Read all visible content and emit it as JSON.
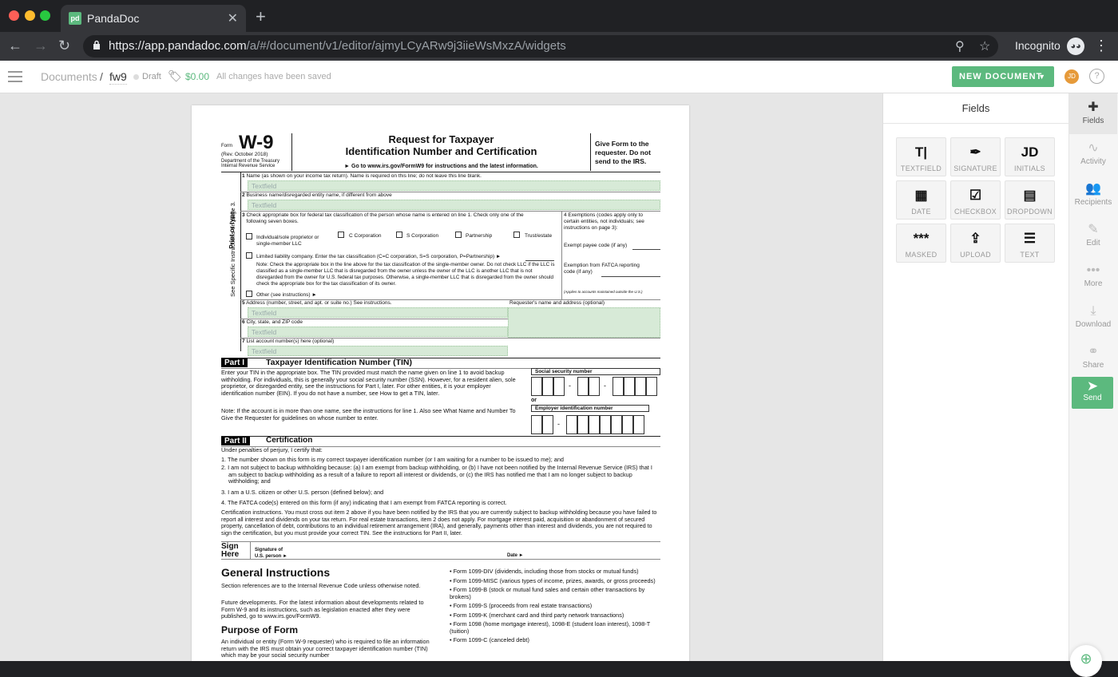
{
  "browser": {
    "tab_title": "PandaDoc",
    "favicon_text": "pd",
    "url_host": "https://app.pandadoc.com",
    "url_path": "/a/#/document/v1/editor/ajmyLCyARw9j3iieWsMxzA/widgets",
    "profile_label": "Incognito",
    "traffic_lights": {
      "close": "#ff5f57",
      "minimize": "#febc2e",
      "maximize": "#28c840"
    }
  },
  "header": {
    "breadcrumb_root": "Documents",
    "separator": "/",
    "doc_name": "fw9",
    "status": "Draft",
    "price": "$0.00",
    "save_status": "All changes have been saved",
    "new_document_label": "NEW DOCUMENT",
    "avatar_initials": "JD",
    "help_label": "?",
    "accent": "#5cb97e"
  },
  "fields_panel": {
    "title": "Fields",
    "tiles": [
      {
        "label": "TEXTFIELD",
        "icon": "textfield-icon",
        "glyph": "T|"
      },
      {
        "label": "SIGNATURE",
        "icon": "pen-nib-icon",
        "glyph": "✒"
      },
      {
        "label": "INITIALS",
        "icon": "initials-icon",
        "glyph": "JD"
      },
      {
        "label": "DATE",
        "icon": "calendar-icon",
        "glyph": "▦"
      },
      {
        "label": "CHECKBOX",
        "icon": "checkbox-icon",
        "glyph": "☑"
      },
      {
        "label": "DROPDOWN",
        "icon": "dropdown-icon",
        "glyph": "▤"
      },
      {
        "label": "MASKED",
        "icon": "masked-icon",
        "glyph": "***"
      },
      {
        "label": "UPLOAD",
        "icon": "upload-icon",
        "glyph": "⇪"
      },
      {
        "label": "TEXT",
        "icon": "text-lines-icon",
        "glyph": "☰"
      }
    ]
  },
  "rail": {
    "items": [
      {
        "label": "Fields",
        "icon": "puzzle-icon",
        "glyph": "✚",
        "active": true
      },
      {
        "label": "Activity",
        "icon": "pulse-icon",
        "glyph": "∿"
      },
      {
        "label": "Recipients",
        "icon": "people-icon",
        "glyph": "👥"
      },
      {
        "label": "Edit",
        "icon": "edit-icon",
        "glyph": "✎"
      },
      {
        "label": "More",
        "icon": "more-icon",
        "glyph": "•••"
      },
      {
        "label": "Download",
        "icon": "download-icon",
        "glyph": "⤓"
      },
      {
        "label": "Share",
        "icon": "link-icon",
        "glyph": "⚭"
      }
    ],
    "send_label": "Send"
  },
  "form": {
    "form_word": "Form",
    "form_number": "W-9",
    "rev": "(Rev. October 2018)",
    "dept1": "Department of the Treasury",
    "dept2": "Internal Revenue Service",
    "title1": "Request for Taxpayer",
    "title2": "Identification Number and Certification",
    "goto": "► Go to www.irs.gov/FormW9 for instructions and the latest information.",
    "give1": "Give Form to the",
    "give2": "requester. Do not",
    "give3": "send to the IRS.",
    "side1": "Print or type.",
    "side2": "See Specific Instructions on page 3.",
    "placeholder": "Textfield",
    "line1": "Name (as shown on your income tax return). Name is required on this line; do not leave this line blank.",
    "line2": "Business name/disregarded entity name, if different from above",
    "line3a": "Check appropriate box for federal tax classification of the person whose name is entered on line 1. Check only one of the",
    "line3b": "following seven boxes.",
    "opt_individual1": "Individual/sole proprietor or",
    "opt_individual2": "single-member LLC",
    "opt_c": "C Corporation",
    "opt_s": "S Corporation",
    "opt_p": "Partnership",
    "opt_t": "Trust/estate",
    "opt_llc": "Limited liability company. Enter the tax classification (C=C corporation, S=S corporation, P=Partnership) ►",
    "note_llc": "Note: Check the appropriate box in the line above for the tax classification of the single-member owner.  Do not check LLC if the LLC is classified as a single-member LLC that is disregarded from the owner unless the owner of the LLC is another LLC that is not disregarded from the owner for U.S. federal tax purposes. Otherwise, a single-member LLC that is disregarded from the owner should check the appropriate box for the tax classification of its owner.",
    "opt_other": "Other (see instructions) ►",
    "ex_title": "4  Exemptions (codes apply only to certain entities, not individuals; see instructions on page 3):",
    "ex_payee": "Exempt payee code (if any)",
    "ex_fatca": "Exemption from FATCA reporting code (if any)",
    "ex_applies": "(Applies to accounts maintained outside the U.S.)",
    "line5": "Address (number, street, and apt. or suite no.) See instructions.",
    "requester": "Requester's name and address (optional)",
    "line6": "City, state, and ZIP code",
    "line7": "List account number(s) here (optional)",
    "part1_tag": "Part I",
    "part1_title": "Taxpayer Identification Number (TIN)",
    "part1_text": "Enter your TIN in the appropriate box. The TIN provided must match the name given on line 1 to avoid backup withholding. For individuals, this is generally your social security number (SSN). However, for a resident alien, sole proprietor, or disregarded entity, see the instructions for Part I, later. For other entities, it is your employer identification number (EIN). If you do not have a number, see How to get a TIN, later.",
    "part1_note": "Note: If the account is in more than one name, see the instructions for line 1. Also see What Name and Number To Give the Requester for guidelines on whose number to enter.",
    "ssn_label": "Social security number",
    "or_label": "or",
    "ein_label": "Employer identification number",
    "part2_tag": "Part II",
    "part2_title": "Certification",
    "cert_intro": "Under penalties of perjury, I certify that:",
    "cert_items": [
      "1. The number shown on this form is my correct taxpayer identification number (or I am waiting for a number to be issued to me); and",
      "2. I am not subject to backup withholding because: (a) I am exempt from backup withholding, or (b) I have not been notified by the Internal Revenue Service (IRS) that I am subject to backup withholding as a result of a failure to report all interest or dividends, or (c) the IRS has notified me that I am no longer subject to backup withholding; and",
      "3. I am a U.S. citizen or other U.S. person (defined below); and",
      "4. The FATCA code(s) entered on this form (if any) indicating that I am exempt from FATCA reporting is correct."
    ],
    "cert_instr": "Certification instructions. You must cross out item 2 above if you have been notified by the IRS that you are currently subject to backup withholding because you have failed to report all interest and dividends on your tax return. For real estate transactions, item 2 does not apply. For mortgage interest paid, acquisition or abandonment of secured property, cancellation of debt, contributions to an individual retirement arrangement (IRA), and generally, payments other than interest and dividends, you are not required to sign the certification, but you must provide your correct TIN. See the instructions for Part II, later.",
    "sign1": "Sign",
    "sign2": "Here",
    "sig_of": "Signature of",
    "sig_person": "U.S. person ►",
    "date_label": "Date ►",
    "gi_title": "General Instructions",
    "gi_p1": "Section references are to the Internal Revenue Code unless otherwise noted.",
    "gi_p2": "Future developments. For the latest information about developments related to Form W-9 and its instructions, such as legislation enacted after they were published, go to www.irs.gov/FormW9.",
    "pf_title": "Purpose of Form",
    "pf_p1": "An individual or entity (Form W-9 requester) who is required to file an information return with the IRS must obtain your correct taxpayer identification number (TIN) which may be your social security number",
    "bullets": [
      "• Form 1099-DIV (dividends, including those from stocks or mutual funds)",
      "• Form 1099-MISC (various types of income, prizes, awards, or gross proceeds)",
      "• Form 1099-B (stock or mutual fund sales and certain other transactions by brokers)",
      "• Form 1099-S (proceeds from real estate transactions)",
      "• Form 1099-K (merchant card and third party network transactions)",
      "• Form 1098 (home mortgage interest), 1098-E (student loan interest), 1098-T (tuition)",
      "• Form 1099-C (canceled debt)"
    ]
  }
}
